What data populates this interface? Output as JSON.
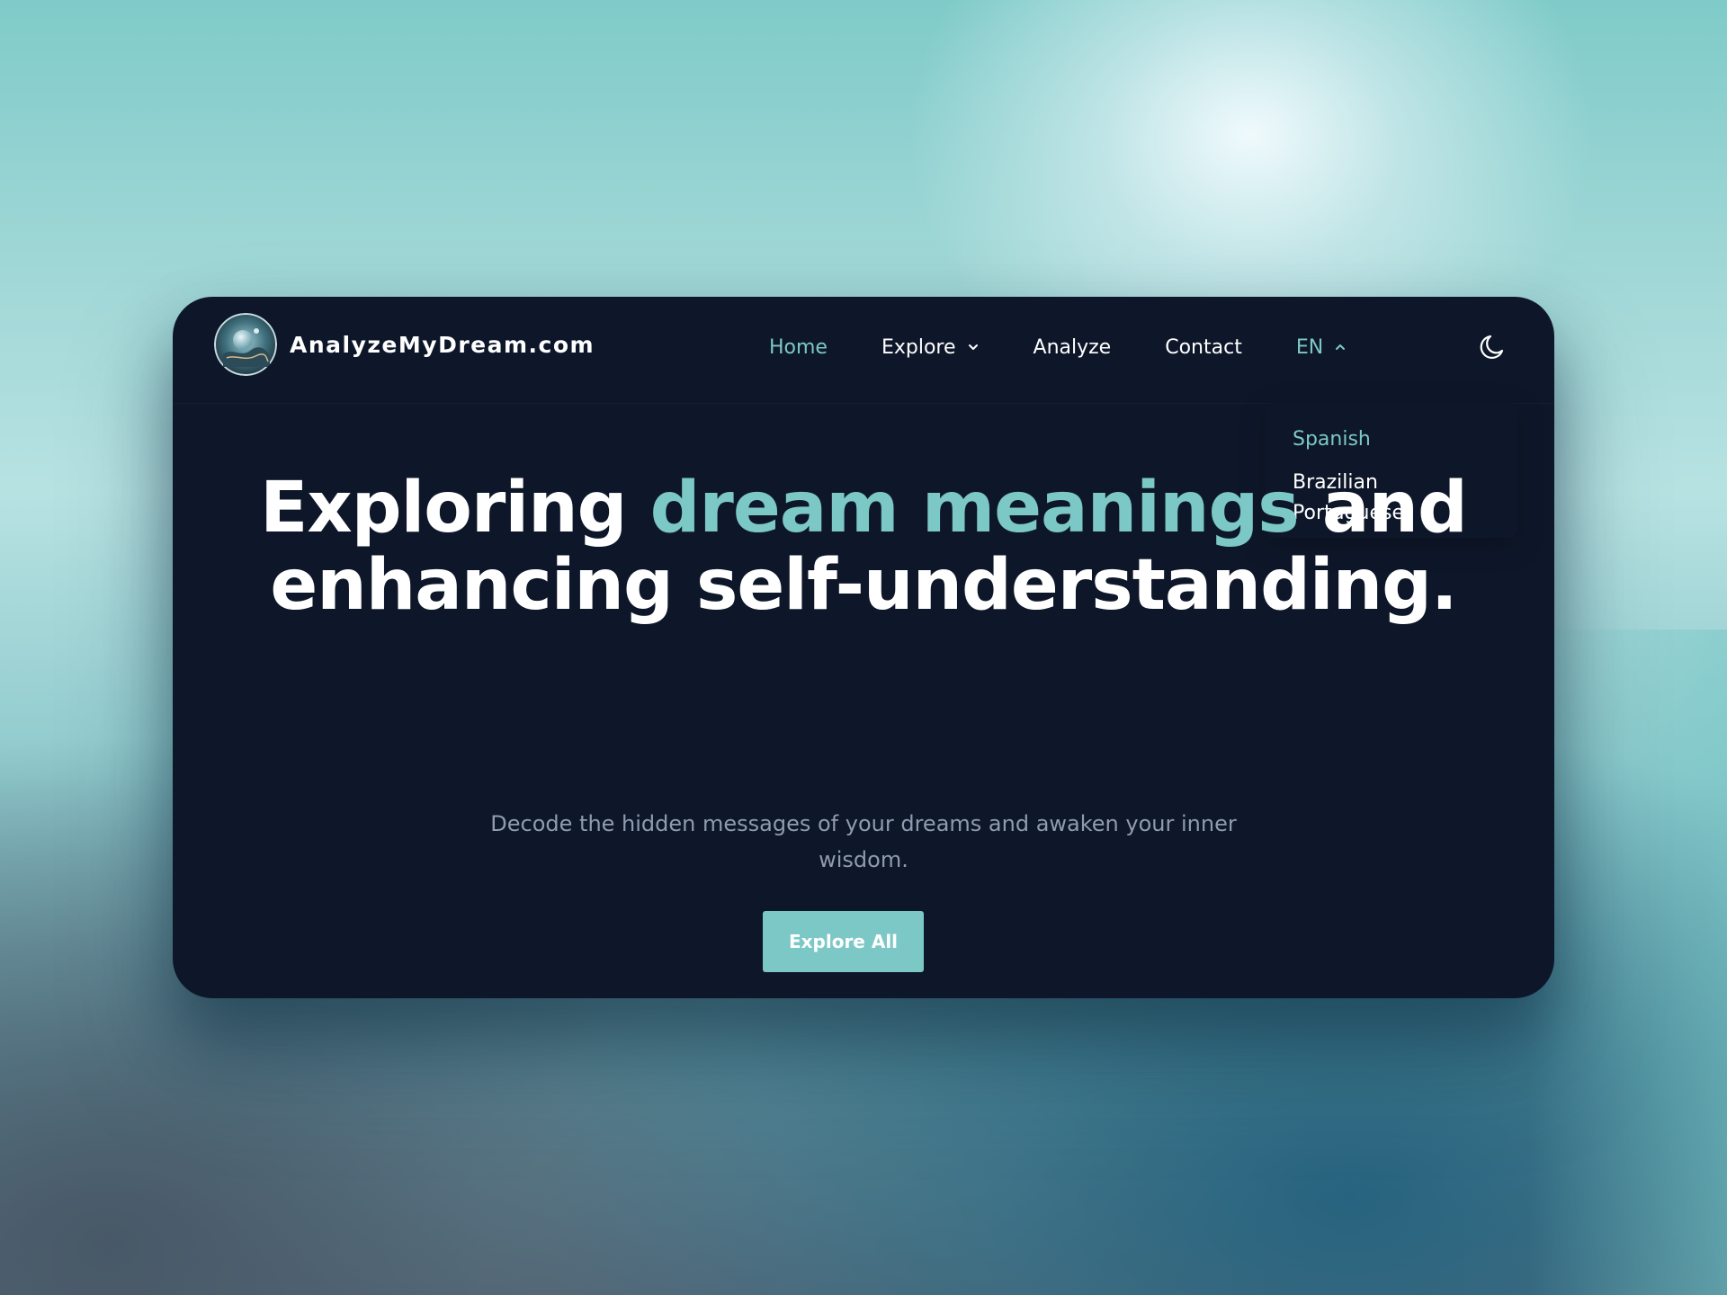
{
  "brand": {
    "name": "AnalyzeMyDream.com",
    "logo_icon": "dream-orb-logo-icon"
  },
  "nav": {
    "items": [
      {
        "label": "Home",
        "active": true
      },
      {
        "label": "Explore",
        "icon": "chevron-down-icon"
      },
      {
        "label": "Analyze"
      },
      {
        "label": "Contact"
      }
    ],
    "language": {
      "current": "EN",
      "icon": "chevron-up-icon",
      "options": [
        "Spanish",
        "Brazilian Portuguese"
      ]
    },
    "theme_toggle_icon": "moon-icon"
  },
  "hero": {
    "title_part1": "Exploring ",
    "title_accent": "dream meanings",
    "title_part2": " and enhancing self-understanding.",
    "subtitle": "Decode the hidden messages of your dreams and awaken your inner wisdom.",
    "cta_label": "Explore All"
  },
  "colors": {
    "accent": "#7cc8c6",
    "card_background": "#0e172a",
    "text_primary": "#ffffff",
    "text_muted": "#8f9bb0"
  }
}
